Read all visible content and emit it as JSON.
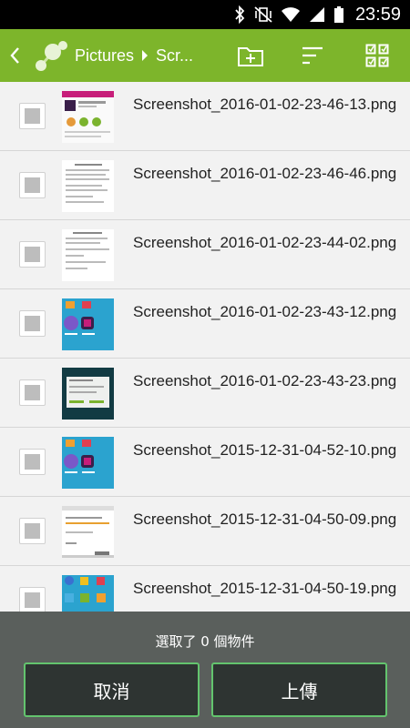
{
  "status_bar": {
    "time": "23:59",
    "icons": [
      "bluetooth-icon",
      "vibrate-mute-icon",
      "wifi-icon",
      "signal-icon",
      "battery-icon"
    ]
  },
  "action_bar": {
    "breadcrumb": [
      "Pictures",
      "Scr..."
    ],
    "icons": [
      "back-icon",
      "app-logo-icon",
      "new-folder-icon",
      "sort-icon",
      "select-all-icon"
    ],
    "accent": "#7db52b"
  },
  "files": [
    {
      "name": "Screenshot_2016-01-02-23-46-13.png",
      "thumb": "store"
    },
    {
      "name": "Screenshot_2016-01-02-23-46-46.png",
      "thumb": "doc"
    },
    {
      "name": "Screenshot_2016-01-02-23-44-02.png",
      "thumb": "doc2"
    },
    {
      "name": "Screenshot_2016-01-02-23-43-12.png",
      "thumb": "blue"
    },
    {
      "name": "Screenshot_2016-01-02-23-43-23.png",
      "thumb": "dialog"
    },
    {
      "name": "Screenshot_2015-12-31-04-52-10.png",
      "thumb": "blue"
    },
    {
      "name": "Screenshot_2015-12-31-04-50-09.png",
      "thumb": "settings"
    },
    {
      "name": "Screenshot_2015-12-31-04-50-19.png",
      "thumb": "home"
    }
  ],
  "bottom": {
    "selection_text": "選取了 0 個物件",
    "cancel_label": "取消",
    "upload_label": "上傳",
    "button_border": "#63c46e"
  }
}
